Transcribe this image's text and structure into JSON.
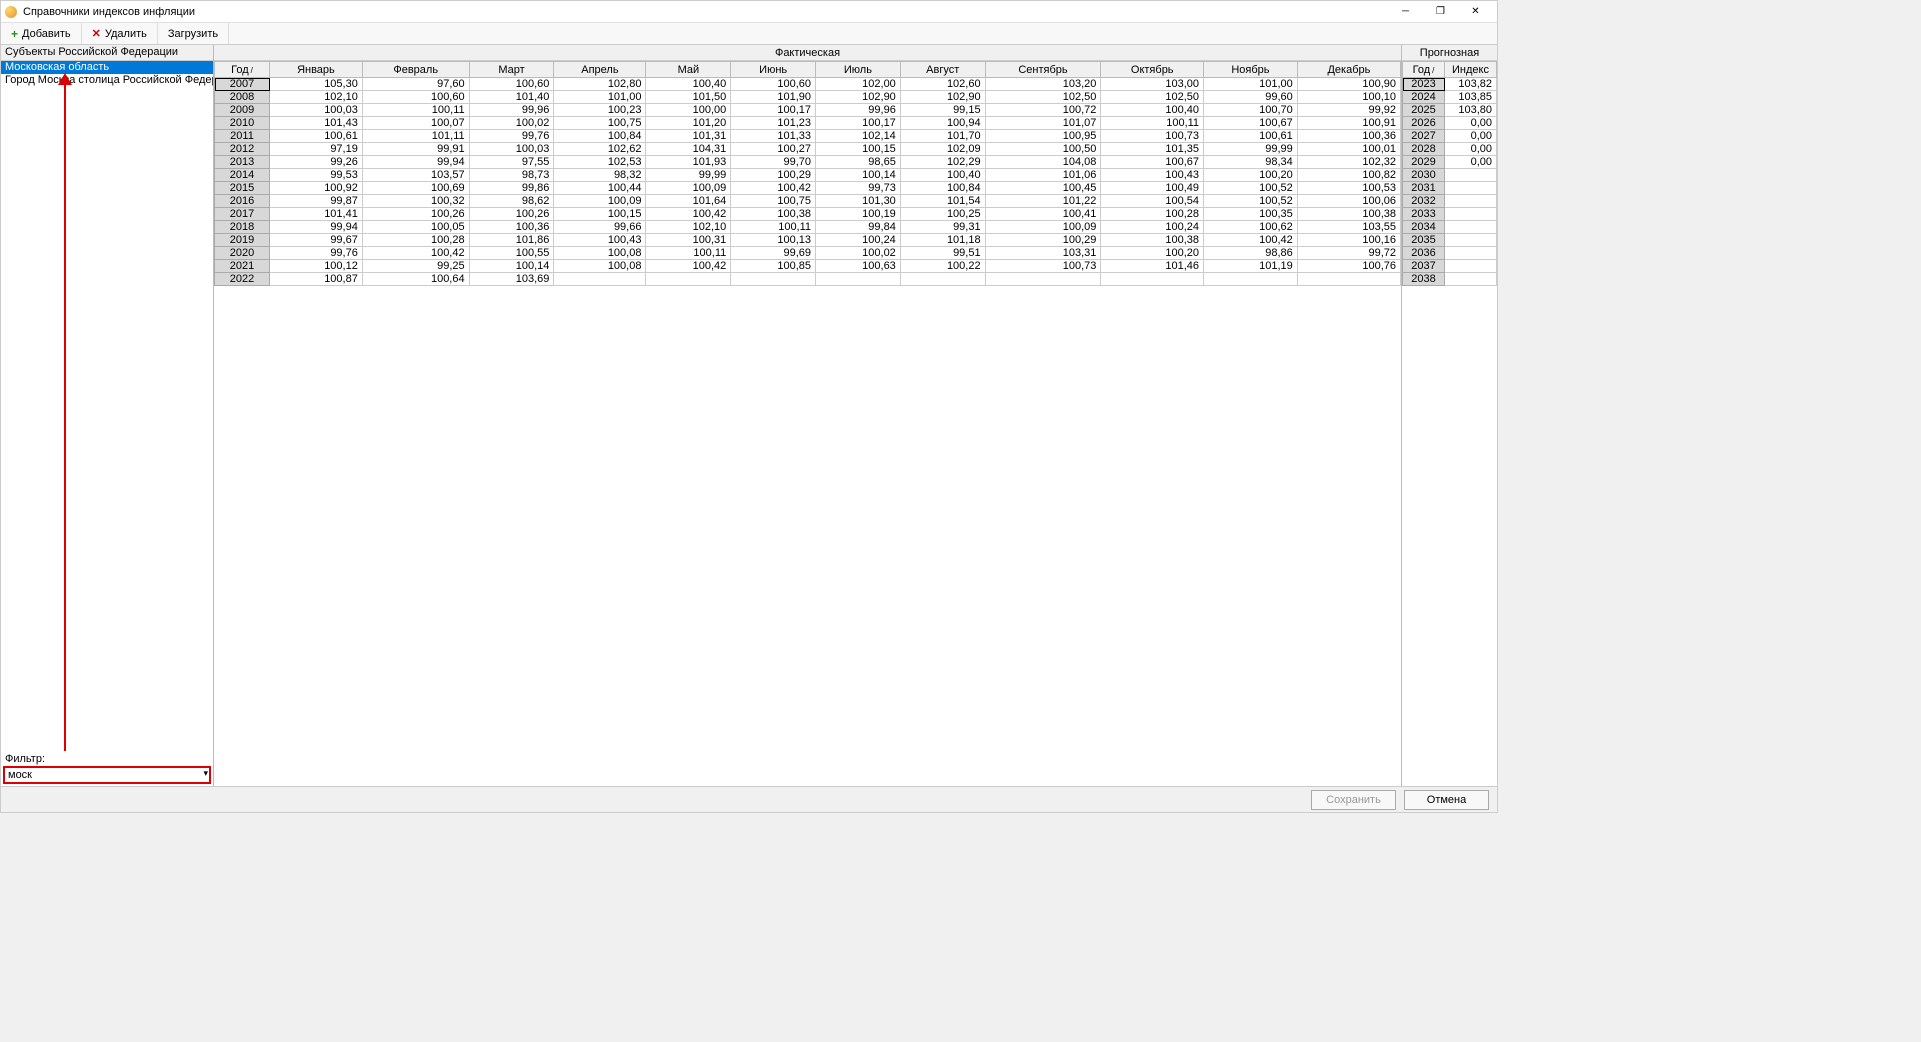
{
  "window": {
    "title": "Справочники индексов инфляции"
  },
  "toolbar": {
    "add": "Добавить",
    "delete": "Удалить",
    "load": "Загрузить"
  },
  "left": {
    "header": "Субъекты Российской Федерации",
    "items": [
      "Московская область",
      "Город Москва столица Российской Федерации го"
    ],
    "filter_label": "Фильтр:",
    "filter_value": "моск"
  },
  "center": {
    "title": "Фактическая",
    "year_hdr": "Год",
    "months": [
      "Январь",
      "Февраль",
      "Март",
      "Апрель",
      "Май",
      "Июнь",
      "Июль",
      "Август",
      "Сентябрь",
      "Октябрь",
      "Ноябрь",
      "Декабрь"
    ],
    "rows": [
      {
        "y": "2007",
        "v": [
          "105,30",
          "97,60",
          "100,60",
          "102,80",
          "100,40",
          "100,60",
          "102,00",
          "102,60",
          "103,20",
          "103,00",
          "101,00",
          "100,90"
        ]
      },
      {
        "y": "2008",
        "v": [
          "102,10",
          "100,60",
          "101,40",
          "101,00",
          "101,50",
          "101,90",
          "102,90",
          "102,90",
          "102,50",
          "102,50",
          "99,60",
          "100,10"
        ]
      },
      {
        "y": "2009",
        "v": [
          "100,03",
          "100,11",
          "99,96",
          "100,23",
          "100,00",
          "100,17",
          "99,96",
          "99,15",
          "100,72",
          "100,40",
          "100,70",
          "99,92"
        ]
      },
      {
        "y": "2010",
        "v": [
          "101,43",
          "100,07",
          "100,02",
          "100,75",
          "101,20",
          "101,23",
          "100,17",
          "100,94",
          "101,07",
          "100,11",
          "100,67",
          "100,91"
        ]
      },
      {
        "y": "2011",
        "v": [
          "100,61",
          "101,11",
          "99,76",
          "100,84",
          "101,31",
          "101,33",
          "102,14",
          "101,70",
          "100,95",
          "100,73",
          "100,61",
          "100,36"
        ]
      },
      {
        "y": "2012",
        "v": [
          "97,19",
          "99,91",
          "100,03",
          "102,62",
          "104,31",
          "100,27",
          "100,15",
          "102,09",
          "100,50",
          "101,35",
          "99,99",
          "100,01"
        ]
      },
      {
        "y": "2013",
        "v": [
          "99,26",
          "99,94",
          "97,55",
          "102,53",
          "101,93",
          "99,70",
          "98,65",
          "102,29",
          "104,08",
          "100,67",
          "98,34",
          "102,32"
        ]
      },
      {
        "y": "2014",
        "v": [
          "99,53",
          "103,57",
          "98,73",
          "98,32",
          "99,99",
          "100,29",
          "100,14",
          "100,40",
          "101,06",
          "100,43",
          "100,20",
          "100,82"
        ]
      },
      {
        "y": "2015",
        "v": [
          "100,92",
          "100,69",
          "99,86",
          "100,44",
          "100,09",
          "100,42",
          "99,73",
          "100,84",
          "100,45",
          "100,49",
          "100,52",
          "100,53"
        ]
      },
      {
        "y": "2016",
        "v": [
          "99,87",
          "100,32",
          "98,62",
          "100,09",
          "101,64",
          "100,75",
          "101,30",
          "101,54",
          "101,22",
          "100,54",
          "100,52",
          "100,06"
        ]
      },
      {
        "y": "2017",
        "v": [
          "101,41",
          "100,26",
          "100,26",
          "100,15",
          "100,42",
          "100,38",
          "100,19",
          "100,25",
          "100,41",
          "100,28",
          "100,35",
          "100,38"
        ]
      },
      {
        "y": "2018",
        "v": [
          "99,94",
          "100,05",
          "100,36",
          "99,66",
          "102,10",
          "100,11",
          "99,84",
          "99,31",
          "100,09",
          "100,24",
          "100,62",
          "103,55"
        ]
      },
      {
        "y": "2019",
        "v": [
          "99,67",
          "100,28",
          "101,86",
          "100,43",
          "100,31",
          "100,13",
          "100,24",
          "101,18",
          "100,29",
          "100,38",
          "100,42",
          "100,16"
        ]
      },
      {
        "y": "2020",
        "v": [
          "99,76",
          "100,42",
          "100,55",
          "100,08",
          "100,11",
          "99,69",
          "100,02",
          "99,51",
          "103,31",
          "100,20",
          "98,86",
          "99,72"
        ]
      },
      {
        "y": "2021",
        "v": [
          "100,12",
          "99,25",
          "100,14",
          "100,08",
          "100,42",
          "100,85",
          "100,63",
          "100,22",
          "100,73",
          "101,46",
          "101,19",
          "100,76"
        ]
      },
      {
        "y": "2022",
        "v": [
          "100,87",
          "100,64",
          "103,69",
          "",
          "",
          "",
          "",
          "",
          "",
          "",
          "",
          ""
        ]
      }
    ]
  },
  "right": {
    "title": "Прогнозная",
    "year_hdr": "Год",
    "idx_hdr": "Индекс",
    "rows": [
      {
        "y": "2023",
        "v": "103,82"
      },
      {
        "y": "2024",
        "v": "103,85"
      },
      {
        "y": "2025",
        "v": "103,80"
      },
      {
        "y": "2026",
        "v": "0,00"
      },
      {
        "y": "2027",
        "v": "0,00"
      },
      {
        "y": "2028",
        "v": "0,00"
      },
      {
        "y": "2029",
        "v": "0,00"
      },
      {
        "y": "2030",
        "v": ""
      },
      {
        "y": "2031",
        "v": ""
      },
      {
        "y": "2032",
        "v": ""
      },
      {
        "y": "2033",
        "v": ""
      },
      {
        "y": "2034",
        "v": ""
      },
      {
        "y": "2035",
        "v": ""
      },
      {
        "y": "2036",
        "v": ""
      },
      {
        "y": "2037",
        "v": ""
      },
      {
        "y": "2038",
        "v": ""
      }
    ]
  },
  "footer": {
    "save": "Сохранить",
    "cancel": "Отмена"
  }
}
